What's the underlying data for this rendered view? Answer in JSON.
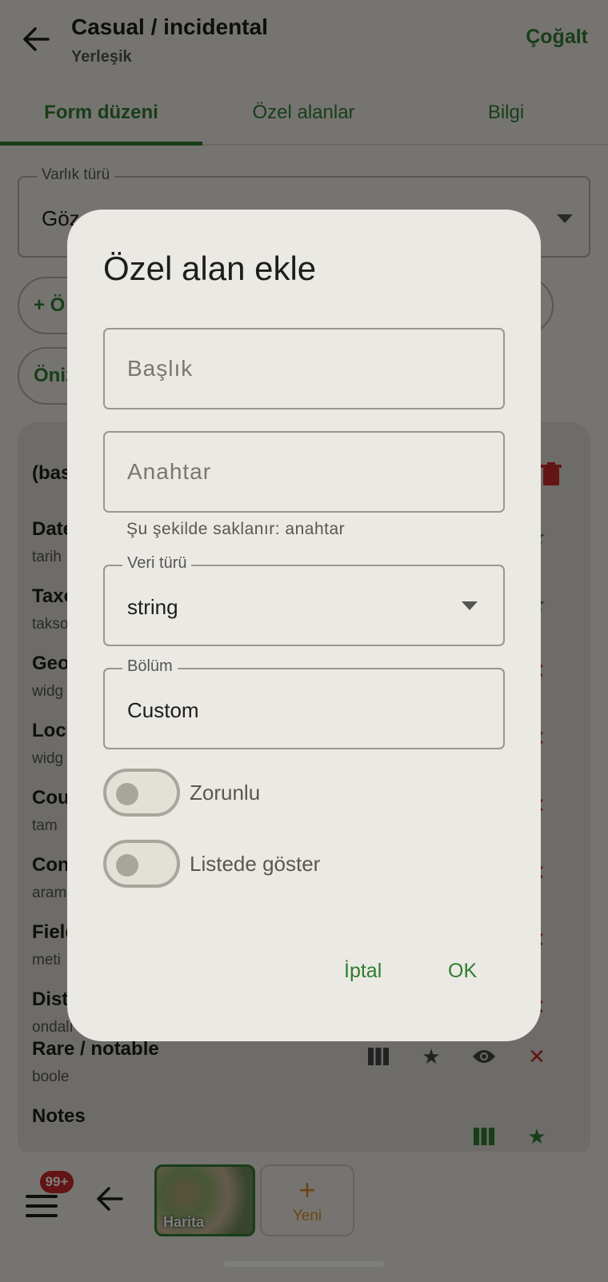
{
  "header": {
    "title": "Casual / incidental",
    "subtitle": "Yerleşik",
    "action_label": "Çoğalt"
  },
  "tabs": [
    {
      "label": "Form düzeni",
      "active": true
    },
    {
      "label": "Özel alanlar",
      "active": false
    },
    {
      "label": "Bilgi",
      "active": false
    }
  ],
  "entity_select": {
    "label": "Varlık türü",
    "value_visible": "Göz"
  },
  "background_buttons": {
    "add_partial": "+ Ö",
    "preview_partial": "Öniz"
  },
  "field_list": {
    "header_partial": "(bas",
    "rows": [
      {
        "name": "Date",
        "type": "tarih"
      },
      {
        "name": "Taxo",
        "type": "takso"
      },
      {
        "name": "Geo",
        "type": "widg"
      },
      {
        "name": "Loc",
        "type": "widg"
      },
      {
        "name": "Cou",
        "type": "tam"
      },
      {
        "name": "Con",
        "type": "aram"
      },
      {
        "name": "Field",
        "type": "meti"
      },
      {
        "name": "Dist",
        "type": "ondalı"
      },
      {
        "name": "Rare / notable",
        "type": "boole"
      },
      {
        "name": "Notes",
        "type": ""
      }
    ]
  },
  "bottom_nav": {
    "badge": "99+",
    "map_label": "Harita",
    "new_label": "Yeni",
    "new_icon": "+"
  },
  "dialog": {
    "title": "Özel alan ekle",
    "title_field": {
      "placeholder": "Başlık",
      "value": ""
    },
    "key_field": {
      "placeholder": "Anahtar",
      "value": ""
    },
    "helper": "Şu şekilde saklanır: anahtar",
    "data_type": {
      "label": "Veri türü",
      "value": "string"
    },
    "section": {
      "label": "Bölüm",
      "value": "Custom"
    },
    "switches": [
      {
        "label": "Zorunlu",
        "on": false
      },
      {
        "label": "Listede göster",
        "on": false
      }
    ],
    "cancel_label": "İptal",
    "ok_label": "OK"
  },
  "colors": {
    "accent": "#2f7d32",
    "danger": "#c62828",
    "orange": "#d48a1e",
    "surface": "#ede9e2"
  }
}
